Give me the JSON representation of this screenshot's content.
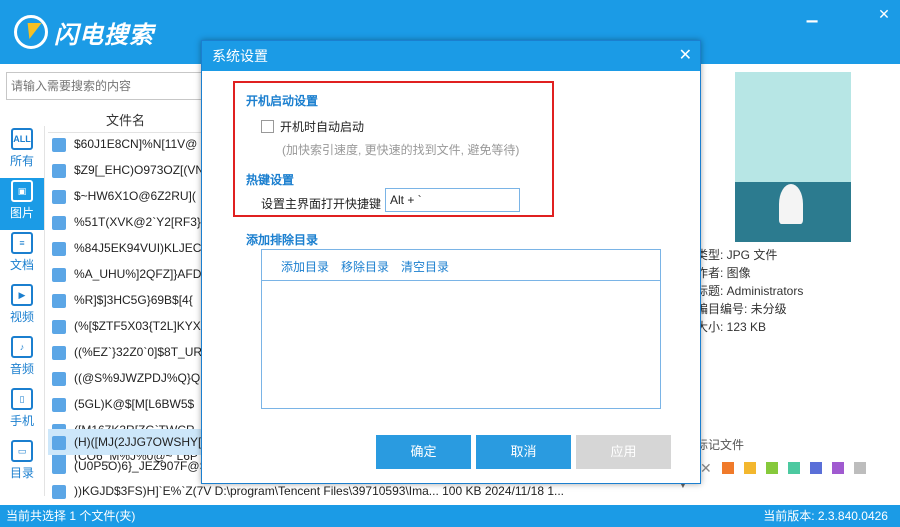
{
  "app": {
    "name": "闪电搜索"
  },
  "window": {
    "min_icon": "minimize-icon",
    "close_icon": "close-icon"
  },
  "search": {
    "placeholder": "请输入需要搜索的内容"
  },
  "categories": [
    {
      "label": "所有",
      "icon": "ALL"
    },
    {
      "label": "图片",
      "icon": "image"
    },
    {
      "label": "文档",
      "icon": "doc"
    },
    {
      "label": "视频",
      "icon": "video"
    },
    {
      "label": "音频",
      "icon": "audio"
    },
    {
      "label": "手机",
      "icon": "phone"
    },
    {
      "label": "目录",
      "icon": "folder"
    }
  ],
  "file_list": {
    "header": "文件名",
    "rows": [
      "$60J1E8CN]%N[11V@",
      "$Z9[_EHC)O973OZ[(VN",
      "$~HW6X1O@6Z2RU](",
      "%51T(XVK@2`Y2[RF3}",
      "%84J5EK94VUI)KLJEC",
      "%A_UHU%]2QFZ]}AFD",
      "%R]$]3HC5G}69B$[4{",
      "(%[$ZTF5X03{T2L]KYX",
      "((%EZ`}32Z0`0]$8T_UR",
      "((@S%9JWZPDJ%Q}Q",
      "(5GL)K@$[M[L6BW5$",
      "([M167K3R[ZG`TWCR",
      "(CO6_M%J%0@~`L6P",
      "(H)([MJ(2JJG7OWSHY[",
      "(U0P5O)6}_JEZ907F@S",
      "))KGJD$3FS)H]`E%`Z(7V   D:\\program\\Tencent Files\\39710593\\Ima...   100 KB  2024/11/18 1..."
    ]
  },
  "preview_info": {
    "type": "类型: JPG 文件",
    "author": "作者: 图像",
    "title": "标题: Administrators",
    "catalog": "编目编号: 未分级",
    "size": "大小: 123 KB"
  },
  "marks": {
    "label": "标记文件",
    "colors": [
      "#f07a2a",
      "#f3b72e",
      "#86c93b",
      "#4cc9a0",
      "#5a6fd8",
      "#a05ad0",
      "#bdbdbd"
    ]
  },
  "status": {
    "left": "当前共选择 1 个文件(夹)",
    "right": "当前版本: 2.3.840.0426"
  },
  "dialog": {
    "title": "系统设置",
    "startup_section": "开机启动设置",
    "auto_start_label": "开机时自动启动",
    "auto_start_checked": false,
    "auto_start_hint": "(加快索引速度, 更快速的找到文件, 避免等待)",
    "hotkey_section": "热键设置",
    "hotkey_label": "设置主界面打开快捷键",
    "hotkey_value": "Alt + `",
    "exclude_section": "添加排除目录",
    "exclude_add": "添加目录",
    "exclude_remove": "移除目录",
    "exclude_clear": "清空目录",
    "ok": "确定",
    "cancel": "取消",
    "apply": "应用"
  }
}
